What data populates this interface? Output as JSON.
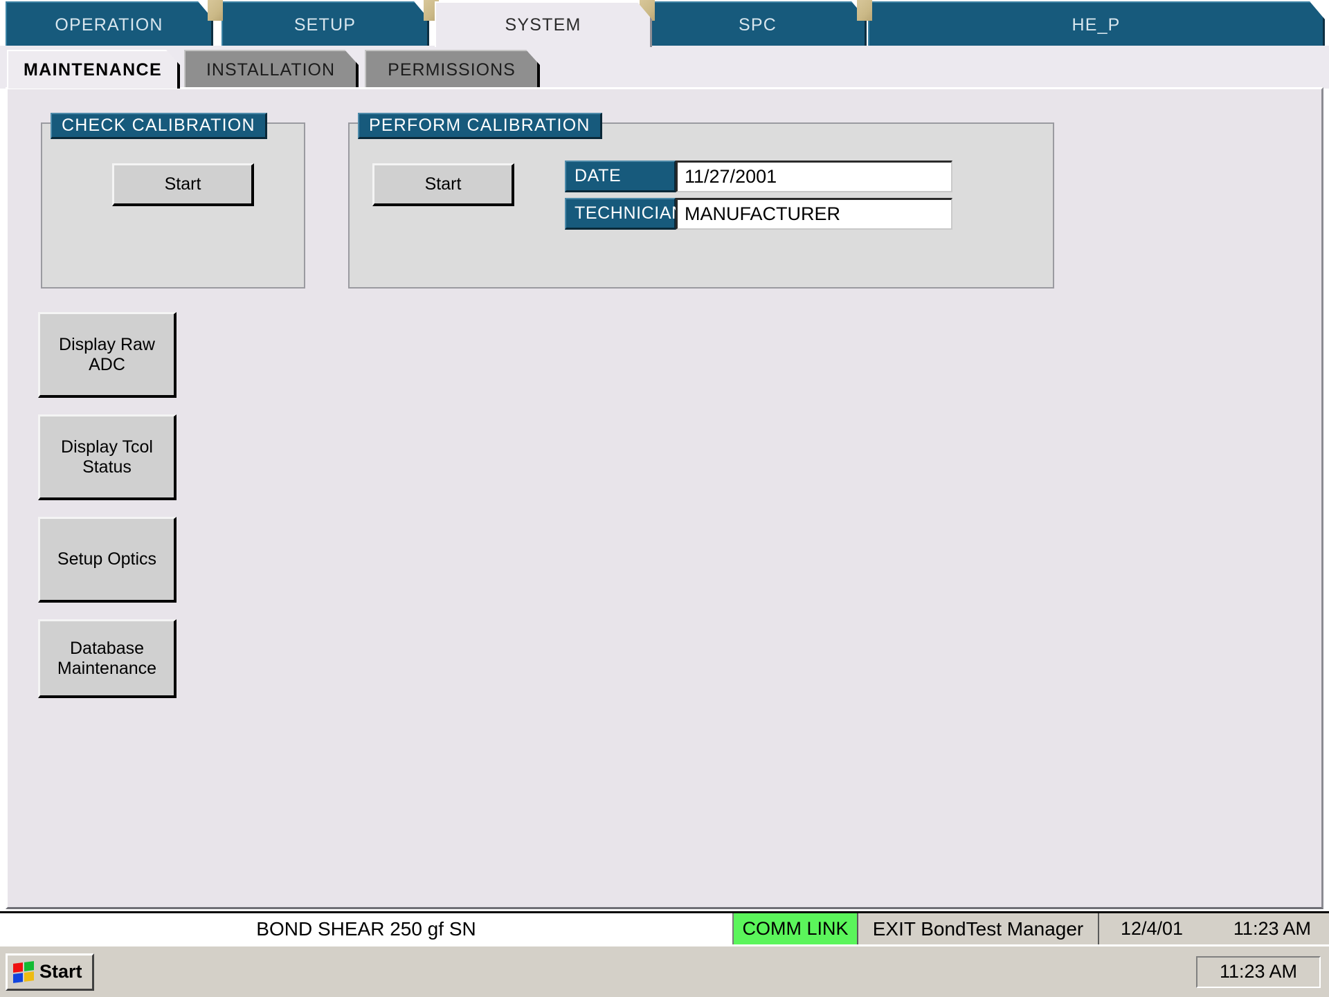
{
  "colors": {
    "accent_teal": "#175a7c",
    "client_bg": "#e8e4ea",
    "panel_bg": "#dcdcdc",
    "button_face": "#d0d0d0",
    "comm_ok_green": "#5bf55b",
    "taskbar": "#d4d0c8"
  },
  "main_tabs": [
    {
      "label": "OPERATION",
      "active": false
    },
    {
      "label": "SETUP",
      "active": false
    },
    {
      "label": "SYSTEM",
      "active": true
    },
    {
      "label": "SPC",
      "active": false
    },
    {
      "label": "HE_P",
      "active": false
    }
  ],
  "sub_tabs": [
    {
      "label": "MAINTENANCE",
      "active": true
    },
    {
      "label": "INSTALLATION",
      "active": false
    },
    {
      "label": "PERMISSIONS",
      "active": false
    }
  ],
  "check_calibration": {
    "title": "CHECK CALIBRATION",
    "start_label": "Start"
  },
  "perform_calibration": {
    "title": "PERFORM CALIBRATION",
    "start_label": "Start",
    "fields": [
      {
        "label": "DATE",
        "value": "11/27/2001"
      },
      {
        "label": "TECHNICIAN",
        "value": "MANUFACTURER"
      }
    ]
  },
  "tool_buttons": [
    {
      "label": "Display Raw ADC"
    },
    {
      "label": "Display Tcol Status"
    },
    {
      "label": "Setup Optics"
    },
    {
      "label": "Database\nMaintenance"
    }
  ],
  "status_bar": {
    "machine": "BOND SHEAR 250 gf   SN",
    "comm_link": "COMM LINK",
    "exit_label": "EXIT BondTest Manager",
    "date": "12/4/01",
    "time": "11:23 AM"
  },
  "taskbar": {
    "start_label": "Start",
    "clock": "11:23 AM"
  }
}
